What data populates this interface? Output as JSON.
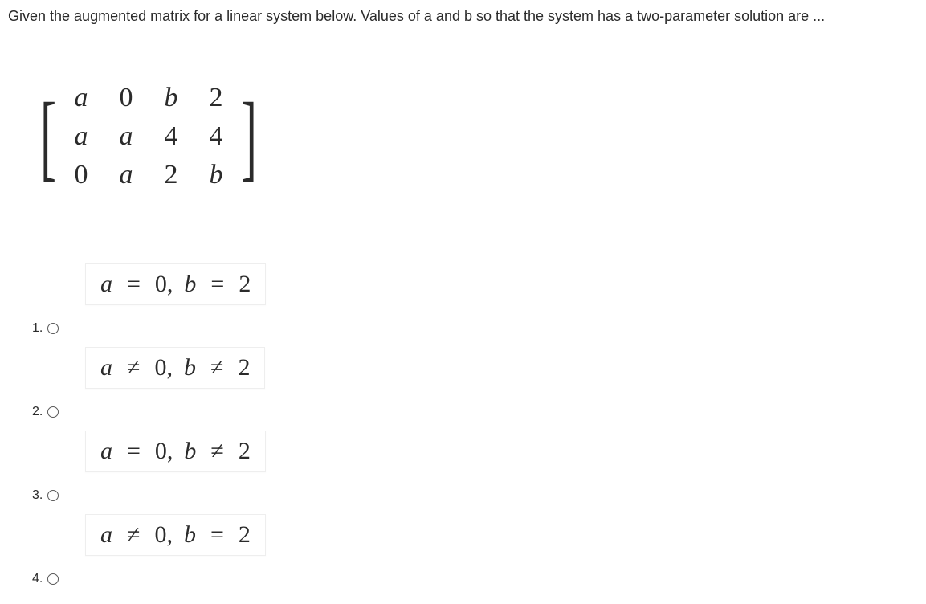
{
  "question": "Given the augmented matrix for a linear system below. Values of a and b so that the system has a two-parameter solution are ...",
  "matrix": {
    "rows": [
      [
        "a",
        "0",
        "b",
        "2"
      ],
      [
        "a",
        "a",
        "4",
        "4"
      ],
      [
        "0",
        "a",
        "2",
        "b"
      ]
    ]
  },
  "options": [
    {
      "number": "1.",
      "parts": [
        "a",
        " = ",
        "0,",
        " b",
        " = ",
        "2"
      ]
    },
    {
      "number": "2.",
      "parts": [
        "a",
        " ≠ ",
        "0,",
        " b",
        " ≠ ",
        "2"
      ]
    },
    {
      "number": "3.",
      "parts": [
        "a",
        " = ",
        "0,",
        " b",
        " ≠ ",
        "2"
      ]
    },
    {
      "number": "4.",
      "parts": [
        "a",
        " ≠ ",
        "0,",
        " b",
        " = ",
        "2"
      ]
    }
  ]
}
